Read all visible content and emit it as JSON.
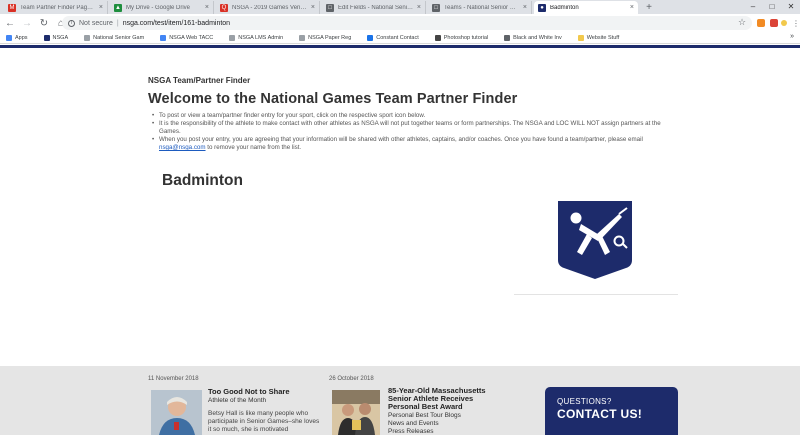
{
  "browser": {
    "tabs": [
      {
        "title": "Team Partner Finder Page - Jheh",
        "color": "#d93025",
        "glyph": "M"
      },
      {
        "title": "My Drive - Google Drive",
        "color": "#1e8e3e",
        "glyph": "▲"
      },
      {
        "title": "NSGA - 2019 Games Venues - G",
        "color": "#d93025",
        "glyph": "Q"
      },
      {
        "title": "Edit Fields - National Senior Ga",
        "color": "#5f6368",
        "glyph": "□"
      },
      {
        "title": "Teams - National Senior Games",
        "color": "#5f6368",
        "glyph": "□"
      },
      {
        "title": "Badminton",
        "color": "#1d2b6b",
        "glyph": "●"
      }
    ],
    "address": {
      "security": "Not secure",
      "url": "nsga.com/test/item/161-badminton"
    },
    "bookmarks": [
      {
        "label": "Apps",
        "color": "#4285f4"
      },
      {
        "label": "NSGA",
        "color": "#1d2b6b"
      },
      {
        "label": "National Senior Gam",
        "color": "#9aa0a6"
      },
      {
        "label": "NSGA Web TACC",
        "color": "#4285f4"
      },
      {
        "label": "NSGA LMS Admin",
        "color": "#9aa0a6"
      },
      {
        "label": "NSGA Paper Reg",
        "color": "#9aa0a6"
      },
      {
        "label": "Constant Contact",
        "color": "#1a73e8"
      },
      {
        "label": "Photoshop tutorial",
        "color": "#444444"
      },
      {
        "label": "Black and White Inv",
        "color": "#5f6368"
      },
      {
        "label": "Website Stuff",
        "color": "#f2c94c"
      }
    ],
    "bookmarks_more": "»"
  },
  "page": {
    "kicker": "NSGA Team/Partner Finder",
    "headline": "Welcome to the National Games Team Partner Finder",
    "bullet1": "To post or view a team/partner finder entry for your sport, click on the respective sport icon below.",
    "bullet2": "It is the responsibility of the athlete to make contact with other athletes as NSGA will not put together teams or form partnerships. The NSGA and LOC WILL NOT assign partners at the Games.",
    "bullet3_pre": "When you post your entry, you are agreeing that your information will be shared with other athletes, captains, and/or coaches. Once you have found a team/partner, please email ",
    "bullet3_link": "nsga@nsga.com",
    "bullet3_post": " to remove your name from the list.",
    "sport_title": "Badminton",
    "sport_icon": "badminton-player-icon"
  },
  "footer": {
    "story1": {
      "date": "11 November 2018",
      "title": "Too Good Not to Share",
      "subtitle": "Athlete of the Month",
      "body": "Betsy Hall is like many people who participate in Senior Games–she loves it so much, she is motivated"
    },
    "story2": {
      "date": "26 October 2018",
      "title_line1": "85-Year-Old Massachusetts",
      "title_line2": "Senior Athlete Receives",
      "title_line3": "Personal Best Award",
      "link1": "Personal Best Tour Blogs",
      "link2": "News and Events",
      "link3": "Press Releases"
    },
    "contact": {
      "question": "QUESTIONS?",
      "cta": "CONTACT US!"
    }
  },
  "colors": {
    "brand_navy": "#1d2b6b",
    "link": "#1d5bbf",
    "footer_bg": "#e5e5e5"
  }
}
